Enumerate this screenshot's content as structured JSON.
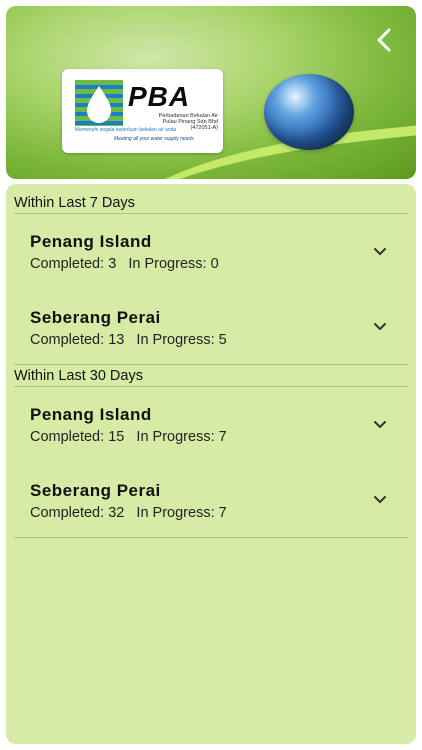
{
  "header": {
    "logo": {
      "brand": "PBA",
      "company_line1": "Perbadanan Bekalan Air",
      "company_line2": "Pulau Pinang Sdn Bhd",
      "reg_no": "(472051-A)",
      "tagline_malay": "Memenuhi segala keperluan bekalan air anda",
      "tagline_english": "Meeting all your water supply needs"
    },
    "back_icon": "chevron-left-icon"
  },
  "sections": [
    {
      "title": "Within Last 7 Days",
      "items": [
        {
          "region": "Penang Island",
          "completed_label": "Completed:",
          "completed": "3",
          "in_progress_label": "In Progress:",
          "in_progress": "0"
        },
        {
          "region": "Seberang Perai",
          "completed_label": "Completed:",
          "completed": "13",
          "in_progress_label": "In Progress:",
          "in_progress": "5"
        }
      ]
    },
    {
      "title": "Within Last 30 Days",
      "items": [
        {
          "region": "Penang Island",
          "completed_label": "Completed:",
          "completed": "15",
          "in_progress_label": "In Progress:",
          "in_progress": "7"
        },
        {
          "region": "Seberang Perai",
          "completed_label": "Completed:",
          "completed": "32",
          "in_progress_label": "In Progress:",
          "in_progress": "7"
        }
      ]
    }
  ],
  "colors": {
    "panel_bg": "#d8eba6",
    "divider": "#a9c87a",
    "logo_blue": "#1a7fc4",
    "logo_green": "#6dbb45"
  }
}
